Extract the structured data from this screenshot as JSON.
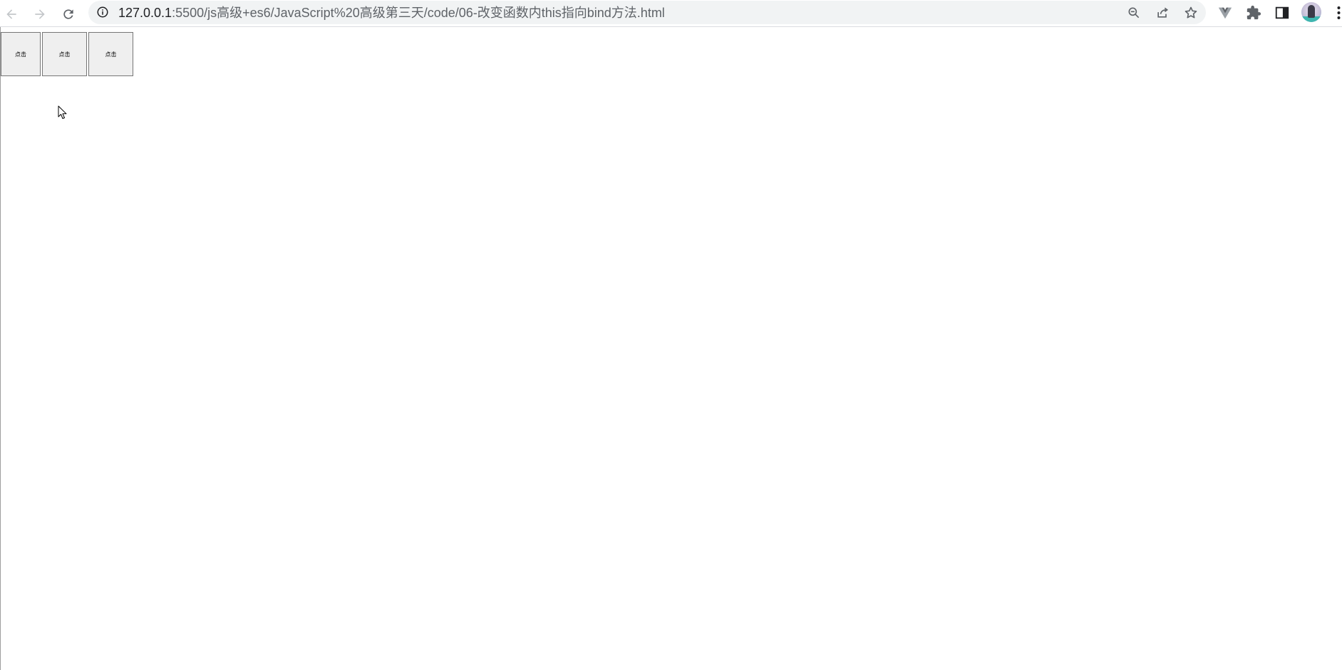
{
  "browser": {
    "url_host": "127.0.0.1",
    "url_rest": ":5500/js高级+es6/JavaScript%20高级第三天/code/06-改变函数内this指向bind方法.html",
    "icons": {
      "back": "arrow-left-icon",
      "forward": "arrow-right-icon",
      "reload": "reload-icon",
      "site_info": "info-icon",
      "zoom": "zoom-out-icon",
      "share": "share-icon",
      "bookmark": "star-icon",
      "vue_devtools": "vue-logo-icon",
      "extensions": "puzzle-icon",
      "side_panel": "side-panel-icon",
      "menu": "kebab-menu-icon"
    }
  },
  "page": {
    "buttons": [
      {
        "label": "点击"
      },
      {
        "label": "点击"
      },
      {
        "label": "点击"
      }
    ]
  },
  "colors": {
    "omnibox_bg": "#f1f3f4",
    "button_bg": "#efefef",
    "button_border": "#767676",
    "icon": "#5f6368"
  }
}
